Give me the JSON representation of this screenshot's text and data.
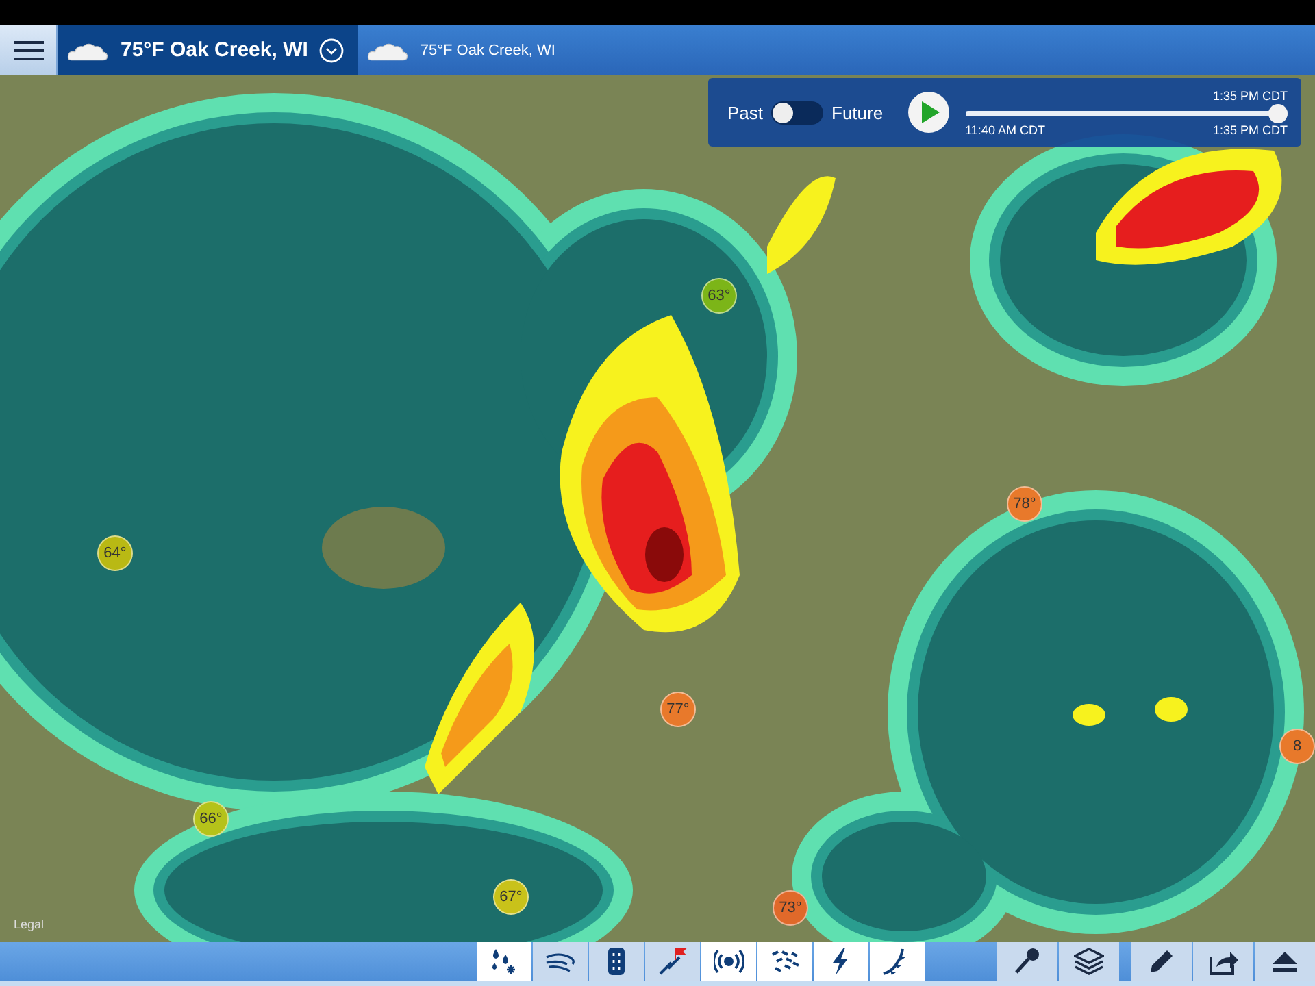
{
  "tabs": [
    {
      "label": "75°F Oak Creek, WI",
      "selected": true
    },
    {
      "label": "75°F Oak Creek, WI",
      "selected": false
    }
  ],
  "timeline": {
    "past_label": "Past",
    "future_label": "Future",
    "future_on": false,
    "level": 1.0,
    "current_time": "1:35 PM CDT",
    "start_time": "11:40 AM CDT",
    "end_time": "1:35 PM CDT"
  },
  "map": {
    "legal_link": "Legal",
    "temperature_markers": [
      {
        "label": "63°",
        "color": "#7cb518"
      },
      {
        "label": "64°",
        "color": "#b9b914"
      },
      {
        "label": "78°",
        "color": "#e8792b"
      },
      {
        "label": "77°",
        "color": "#e8792b"
      },
      {
        "label": "66°",
        "color": "#b5c21a"
      },
      {
        "label": "67°",
        "color": "#c9c21a"
      },
      {
        "label": "73°",
        "color": "#e0692a"
      },
      {
        "label": "8",
        "color": "#e8792b"
      }
    ]
  },
  "layer_toggles": [
    {
      "kind": "precipitation",
      "selected": true
    },
    {
      "kind": "wind",
      "selected": false
    },
    {
      "kind": "temperature",
      "selected": false
    },
    {
      "kind": "warnings",
      "selected": false
    },
    {
      "kind": "radar",
      "selected": true
    },
    {
      "kind": "flow",
      "selected": true
    },
    {
      "kind": "lightning",
      "selected": true
    },
    {
      "kind": "fronts",
      "selected": true
    }
  ],
  "tools": [
    {
      "kind": "key"
    },
    {
      "kind": "layers"
    },
    {
      "kind": "draw"
    },
    {
      "kind": "share"
    },
    {
      "kind": "eject"
    }
  ]
}
